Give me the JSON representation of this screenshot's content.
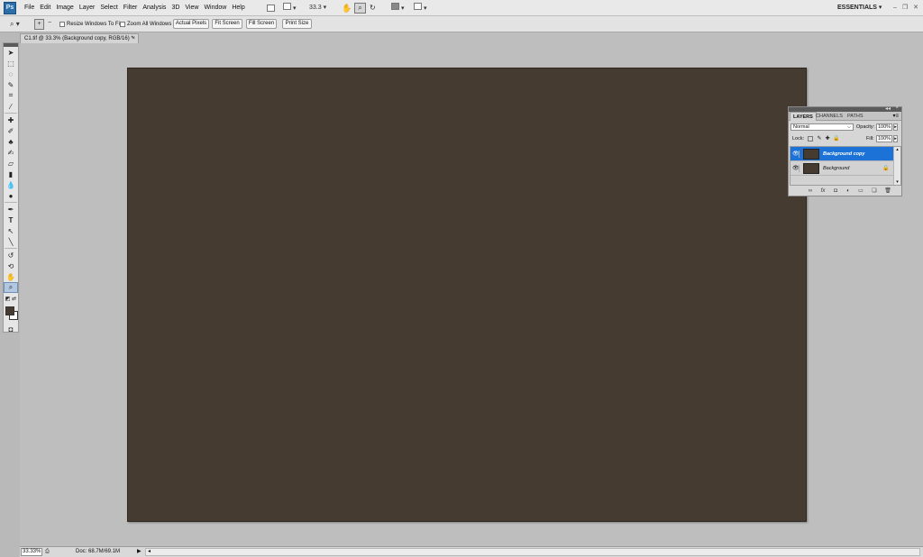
{
  "app": {
    "logo": "Ps",
    "workspace": "ESSENTIALS"
  },
  "menubar": {
    "items": [
      "File",
      "Edit",
      "Image",
      "Layer",
      "Select",
      "Filter",
      "Analysis",
      "3D",
      "View",
      "Window",
      "Help"
    ],
    "zoom_value": "33.3"
  },
  "options": {
    "resize_windows": "Resize Windows To Fit",
    "zoom_all": "Zoom All Windows",
    "actual_pixels": "Actual Pixels",
    "fit_screen": "Fit Screen",
    "fill_screen": "Fill Screen",
    "print_size": "Print Size"
  },
  "document": {
    "tab_title": "C1.tif @ 33.3% (Background copy, RGB/16) *",
    "close": "×",
    "canvas_color": "#453b30"
  },
  "status": {
    "zoom": "33.33%",
    "doc_size": "Doc: 68.7M/69.1M"
  },
  "layers_panel": {
    "tabs": [
      "LAYERS",
      "CHANNELS",
      "PATHS"
    ],
    "blend_mode": "Normal",
    "opacity_label": "Opacity:",
    "opacity": "100%",
    "lock_label": "Lock:",
    "fill_label": "Fill:",
    "fill": "100%",
    "layers": [
      {
        "name": "Background copy",
        "selected": true
      },
      {
        "name": "Background",
        "selected": false,
        "locked": true
      }
    ]
  },
  "colors": {
    "foreground": "#453b30",
    "background": "#ffffff",
    "selection": "#1c72d6"
  }
}
